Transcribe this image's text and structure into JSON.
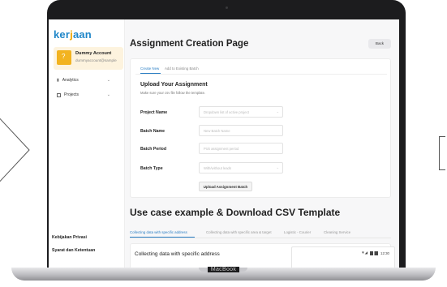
{
  "sidebar": {
    "logo_prefix": "ker",
    "logo_mid": "j",
    "logo_suffix": "aan",
    "account_name": "Dummy Account",
    "account_email": "dummyaccount@sample",
    "nav": [
      {
        "label": "Analytics",
        "icon": "bar-chart-icon"
      },
      {
        "label": "Projects",
        "icon": "document-icon"
      }
    ],
    "footer": [
      "Kebijakan Privasi",
      "Syarat dan Ketentuan"
    ]
  },
  "main": {
    "title": "Assignment Creation Page",
    "back_label": "Back",
    "tabs": [
      "Create New",
      "Add to Existing Batch"
    ],
    "upload_title": "Upload Your Assignment",
    "upload_subtitle": "Make sure your csv file follow the template.",
    "fields": [
      {
        "label": "Project Name",
        "placeholder": "Dropdown list of active project",
        "dropdown": true
      },
      {
        "label": "Batch Name",
        "placeholder": "New Batch Name",
        "dropdown": false
      },
      {
        "label": "Batch Period",
        "placeholder": "Pick assignment period",
        "dropdown": false
      },
      {
        "label": "Batch Type",
        "placeholder": "With/without leads",
        "dropdown": true
      }
    ],
    "upload_button": "Upload Assignment Batch",
    "case_title": "Use case example & Download CSV Template",
    "case_tabs": [
      "Collecting data with specific address",
      "Collecting data with specific area & target",
      "Logistic - Courier",
      "Cleaning Service"
    ],
    "case_subtitle": "Collecting data with specific address",
    "phone_time": "12:30"
  },
  "device_label": "MacBook",
  "colors": {
    "accent": "#2a7ec4",
    "logo": "#1f86c8",
    "brand_yellow": "#f2b320"
  }
}
